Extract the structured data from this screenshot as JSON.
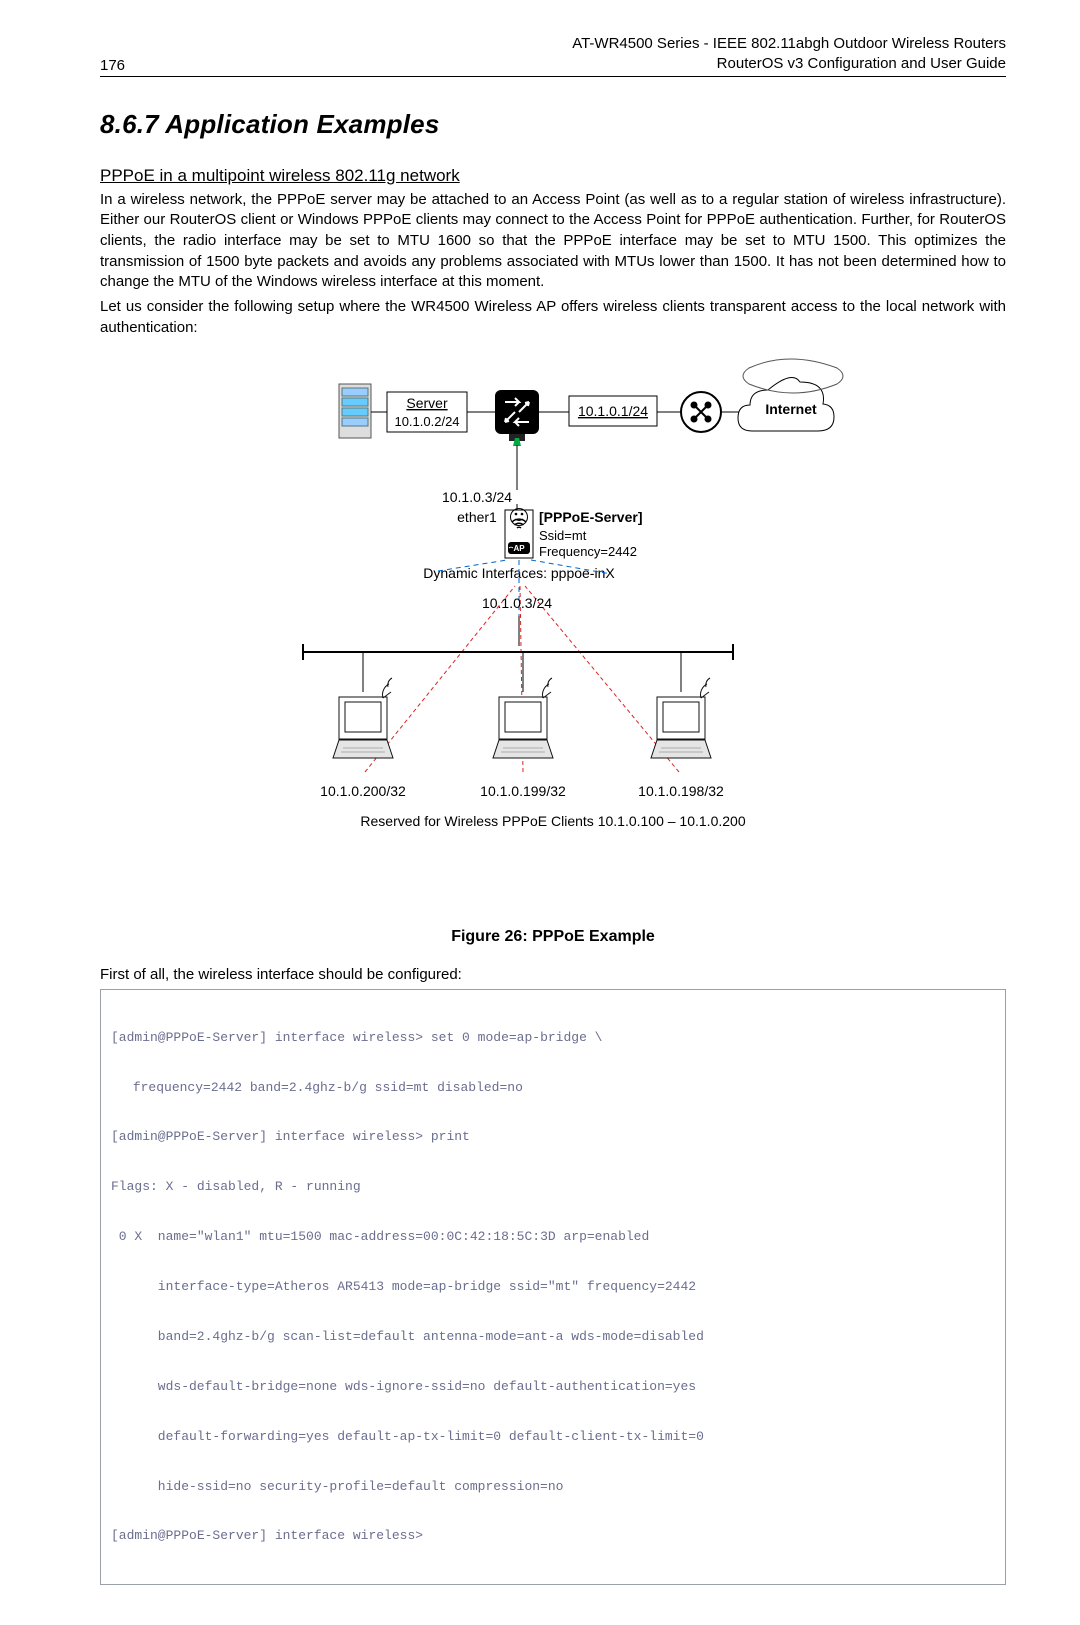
{
  "header": {
    "pageNumber": "176",
    "titleLine1": "AT-WR4500 Series - IEEE 802.11abgh Outdoor Wireless Routers",
    "titleLine2": "RouterOS v3 Configuration and User Guide"
  },
  "section": {
    "number": "8.6.7",
    "title": "Application Examples",
    "subHeading": "PPPoE in a multipoint wireless 802.11g network",
    "para1": "In a wireless network, the PPPoE server may be attached to an Access Point (as well as to a regular station of wireless infrastructure). Either our RouterOS client or Windows PPPoE clients may connect to the Access Point for PPPoE authentication. Further, for RouterOS clients, the radio interface may be set to MTU 1600 so that the PPPoE interface may be set to MTU 1500. This optimizes the transmission of 1500 byte packets and avoids any problems associated with MTUs lower than 1500. It has not been determined how to change the MTU of the Windows wireless interface at this moment.",
    "para2": "Let us consider the following setup where the WR4500 Wireless AP offers wireless clients transparent access to the local network with authentication:"
  },
  "figure": {
    "serverLabel": "Server",
    "serverIp": "10.1.0.2/24",
    "routerIp": "10.1.0.1/24",
    "internet": "Internet",
    "midIp": "10.1.0.3/24",
    "ether1": "ether1",
    "pppoeServer": "[PPPoE-Server]",
    "ssid": "Ssid=mt",
    "freq": "Frequency=2442",
    "dynIf": "Dynamic Interfaces: pppoe-inX",
    "clientNet": "10.1.0.3/24",
    "c1": "10.1.0.200/32",
    "c2": "10.1.0.199/32",
    "c3": "10.1.0.198/32",
    "reserved": "Reserved for Wireless PPPoE Clients 10.1.0.100 – 10.1.0.200",
    "caption": "Figure 26: PPPoE Example"
  },
  "codeLead": "First of all, the wireless interface should be configured:",
  "code": {
    "l1": "[admin@PPPoE-Server] interface wireless> set 0 mode=ap-bridge \\",
    "l2": "frequency=2442 band=2.4ghz-b/g ssid=mt disabled=no",
    "l3": "[admin@PPPoE-Server] interface wireless> print",
    "l4": "Flags: X - disabled, R - running",
    "l5": " 0 X  name=\"wlan1\" mtu=1500 mac-address=00:0C:42:18:5C:3D arp=enabled",
    "l6": "interface-type=Atheros AR5413 mode=ap-bridge ssid=\"mt\" frequency=2442",
    "l7": "band=2.4ghz-b/g scan-list=default antenna-mode=ant-a wds-mode=disabled",
    "l8": "wds-default-bridge=none wds-ignore-ssid=no default-authentication=yes",
    "l9": "default-forwarding=yes default-ap-tx-limit=0 default-client-tx-limit=0",
    "l10": "hide-ssid=no security-profile=default compression=no",
    "l11": "[admin@PPPoE-Server] interface wireless>"
  }
}
